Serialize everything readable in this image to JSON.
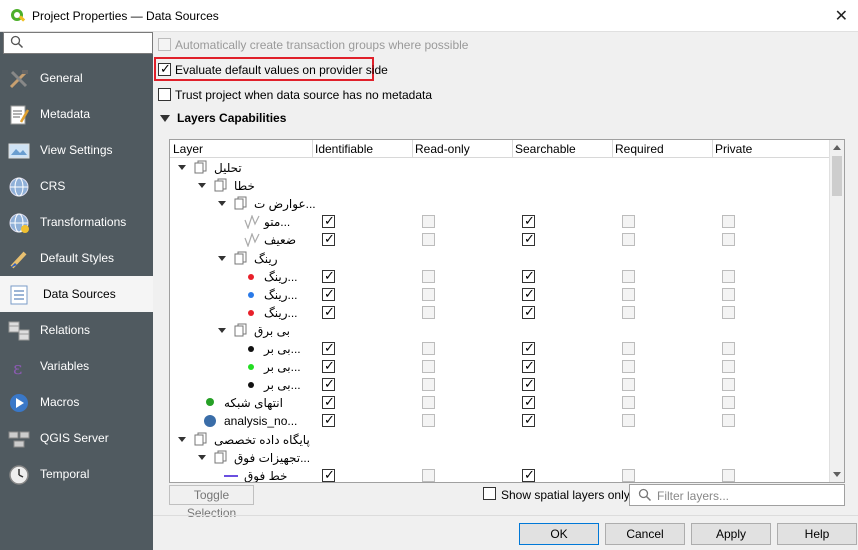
{
  "window": {
    "title": "Project Properties — Data Sources"
  },
  "sidebar": {
    "search_placeholder": "",
    "items": [
      {
        "label": "General",
        "icon": "tools-icon"
      },
      {
        "label": "Metadata",
        "icon": "metadata-icon"
      },
      {
        "label": "View Settings",
        "icon": "view-settings-icon"
      },
      {
        "label": "CRS",
        "icon": "globe-icon"
      },
      {
        "label": "Transformations",
        "icon": "transform-globe-icon"
      },
      {
        "label": "Default Styles",
        "icon": "paintbrush-icon"
      },
      {
        "label": "Data Sources",
        "icon": "data-sources-icon",
        "active": true
      },
      {
        "label": "Relations",
        "icon": "relations-icon"
      },
      {
        "label": "Variables",
        "icon": "variables-icon"
      },
      {
        "label": "Macros",
        "icon": "macros-icon"
      },
      {
        "label": "QGIS Server",
        "icon": "server-icon"
      },
      {
        "label": "Temporal",
        "icon": "clock-icon"
      }
    ]
  },
  "options": {
    "auto_transaction": "Automatically create transaction groups where possible",
    "evaluate_defaults": "Evaluate default values on provider side",
    "trust_project": "Trust project when data source has no metadata"
  },
  "layers": {
    "title": "Layers Capabilities",
    "columns": [
      "Layer",
      "Identifiable",
      "Read-only",
      "Searchable",
      "Required",
      "Private"
    ],
    "rows": [
      {
        "name": "تحلیل",
        "level": 0,
        "kind": "group"
      },
      {
        "name": "خطا",
        "level": 1,
        "kind": "group"
      },
      {
        "name": "عوارض ت...",
        "level": 2,
        "kind": "group"
      },
      {
        "name": "متو...",
        "level": 3,
        "kind": "line-gray",
        "identifiable": true,
        "searchable": true
      },
      {
        "name": "ضعیف",
        "level": 3,
        "kind": "line-gray",
        "identifiable": true,
        "searchable": true
      },
      {
        "name": "رینگ",
        "level": 2,
        "kind": "group"
      },
      {
        "name": "رینگ...",
        "level": 3,
        "kind": "point",
        "color": "#e8202a",
        "identifiable": true,
        "searchable": true
      },
      {
        "name": "رینگ...",
        "level": 3,
        "kind": "point",
        "color": "#2a7ae8",
        "identifiable": true,
        "searchable": true
      },
      {
        "name": "رینگ...",
        "level": 3,
        "kind": "point",
        "color": "#e8202a",
        "identifiable": true,
        "searchable": true
      },
      {
        "name": "بی برق",
        "level": 2,
        "kind": "group"
      },
      {
        "name": "بی بر...",
        "level": 3,
        "kind": "point",
        "color": "#111111",
        "identifiable": true,
        "searchable": true
      },
      {
        "name": "بی بر...",
        "level": 3,
        "kind": "point",
        "color": "#22dd22",
        "identifiable": true,
        "searchable": true
      },
      {
        "name": "بی بر...",
        "level": 3,
        "kind": "point",
        "color": "#111111",
        "identifiable": true,
        "searchable": true
      },
      {
        "name": "انتهای شبکه",
        "level": 1,
        "kind": "green-point",
        "identifiable": true,
        "searchable": true
      },
      {
        "name": "analysis_no...",
        "level": 1,
        "kind": "big-point",
        "identifiable": true,
        "searchable": true
      },
      {
        "name": "پایگاه داده تخصصی",
        "level": 0,
        "kind": "group"
      },
      {
        "name": "تجهیزات فوق...",
        "level": 1,
        "kind": "group"
      },
      {
        "name": "خط فوق",
        "level": 2,
        "kind": "line-purple",
        "identifiable": true,
        "searchable": true
      }
    ]
  },
  "toggle_selection": "Toggle Selection",
  "show_spatial_only": "Show spatial layers only",
  "filter_placeholder": "Filter layers...",
  "buttons": {
    "ok": "OK",
    "cancel": "Cancel",
    "apply": "Apply",
    "help": "Help"
  },
  "colors": {
    "sidebar_bg": "#505a60",
    "highlight": "#e0202a",
    "primary_border": "#0078d7"
  }
}
